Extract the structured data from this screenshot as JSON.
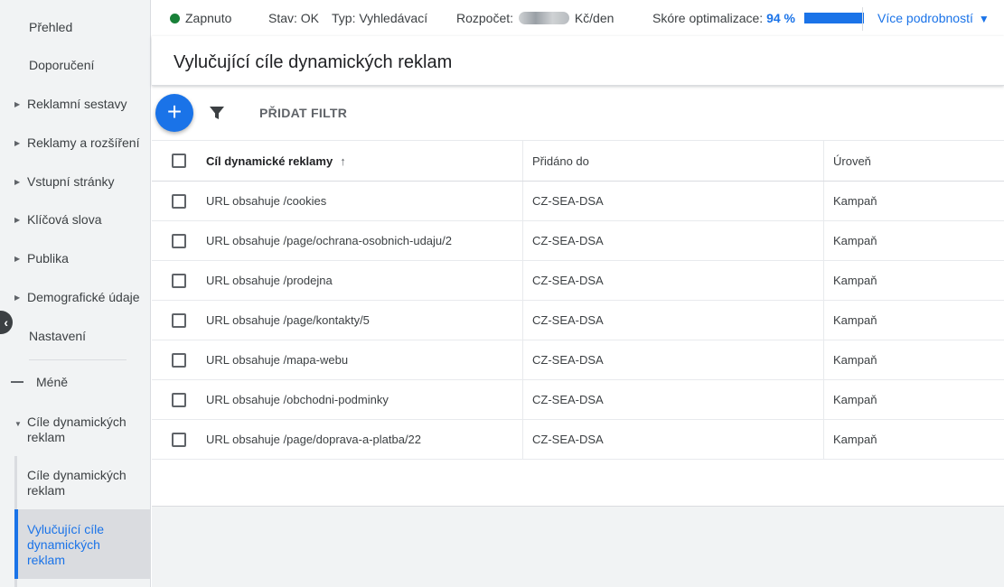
{
  "sidebar": {
    "items": [
      {
        "label": "Přehled",
        "expandable": false
      },
      {
        "label": "Doporučení",
        "expandable": false
      },
      {
        "label": "Reklamní sestavy",
        "expandable": true
      },
      {
        "label": "Reklamy a rozšíření",
        "expandable": true
      },
      {
        "label": "Vstupní stránky",
        "expandable": true
      },
      {
        "label": "Klíčová slova",
        "expandable": true
      },
      {
        "label": "Publika",
        "expandable": true
      },
      {
        "label": "Demografické údaje",
        "expandable": true
      },
      {
        "label": "Nastavení",
        "expandable": false
      }
    ],
    "less_label": "Méně",
    "group_label": "Cíle dynamických reklam",
    "sub_items": [
      {
        "label": "Cíle dynamických reklam",
        "active": false
      },
      {
        "label": "Vylučující cíle dynamických reklam",
        "active": true
      }
    ]
  },
  "topbar": {
    "status": "Zapnuto",
    "state": "Stav: OK",
    "type": "Typ: Vyhledávací",
    "budget_label": "Rozpočet:",
    "budget_unit": "Kč/den",
    "optimization_label": "Skóre optimalizace:",
    "optimization_value": "94 %",
    "optimization_score": 94,
    "more_details": "Více podrobností"
  },
  "page": {
    "title": "Vylučující cíle dynamických reklam"
  },
  "toolbar": {
    "add_filter": "PŘIDAT FILTR"
  },
  "table": {
    "columns": [
      "Cíl dynamické reklamy",
      "Přidáno do",
      "Úroveň"
    ],
    "rows": [
      {
        "target": "URL obsahuje /cookies",
        "added_to": "CZ-SEA-DSA",
        "level": "Kampaň"
      },
      {
        "target": "URL obsahuje /page/ochrana-osobnich-udaju/2",
        "added_to": "CZ-SEA-DSA",
        "level": "Kampaň"
      },
      {
        "target": "URL obsahuje /prodejna",
        "added_to": "CZ-SEA-DSA",
        "level": "Kampaň"
      },
      {
        "target": "URL obsahuje /page/kontakty/5",
        "added_to": "CZ-SEA-DSA",
        "level": "Kampaň"
      },
      {
        "target": "URL obsahuje /mapa-webu",
        "added_to": "CZ-SEA-DSA",
        "level": "Kampaň"
      },
      {
        "target": "URL obsahuje /obchodni-podminky",
        "added_to": "CZ-SEA-DSA",
        "level": "Kampaň"
      },
      {
        "target": "URL obsahuje /page/doprava-a-platba/22",
        "added_to": "CZ-SEA-DSA",
        "level": "Kampaň"
      }
    ]
  },
  "colors": {
    "accent": "#1a73e8",
    "status_on": "#188038"
  }
}
